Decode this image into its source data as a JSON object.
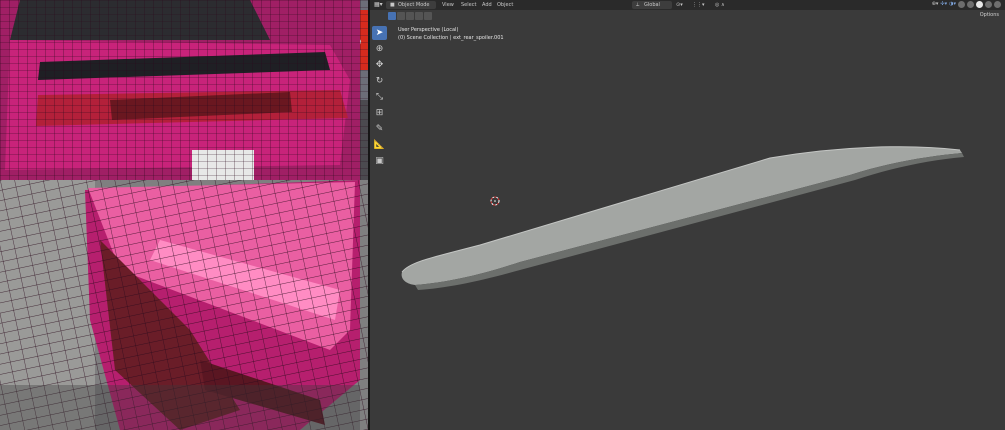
{
  "header": {
    "editor_type_icon": "3d-viewport-icon",
    "mode": "Object Mode",
    "menus": [
      "View",
      "Select",
      "Add",
      "Object"
    ],
    "transform_orientation": "Global",
    "options_label": "Options"
  },
  "viewport": {
    "perspective": "User Perspective (Local)",
    "collection": "(0) Scene Collection | ext_rear_spoiler.001"
  },
  "toolbar": {
    "tools": [
      "select-box-icon",
      "cursor-icon",
      "move-icon",
      "rotate-icon",
      "scale-icon",
      "transform-icon",
      "annotate-icon",
      "measure-icon",
      "add-cube-icon"
    ],
    "active": "select-box-icon"
  },
  "reference_images": [
    "car-rear-top-reference",
    "car-rear-spoiler-closeup-reference"
  ],
  "colors": {
    "car_paint": "#c8237a",
    "viewport_bg": "#3a3a3a",
    "accent": "#4772b3",
    "model": "#a3a6a3"
  }
}
